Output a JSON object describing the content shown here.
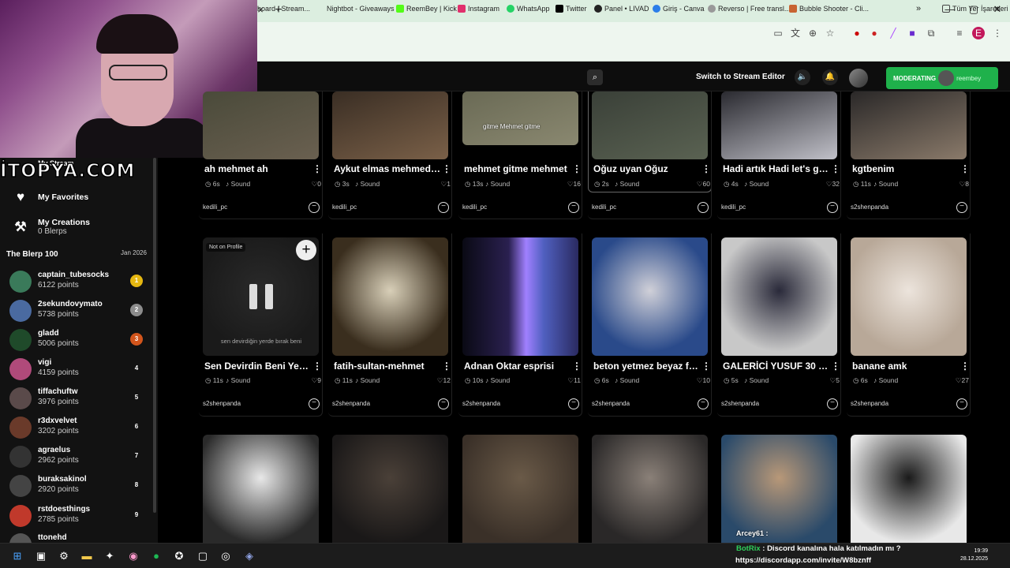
{
  "browser": {
    "tab_close": "×",
    "new_tab": "+",
    "window_controls": [
      "—",
      "▢",
      "✕"
    ],
    "bookmarks": [
      {
        "label": "board / Stream...",
        "color": "#666666"
      },
      {
        "label": "Nightbot - Giveaways",
        "color": ""
      },
      {
        "label": "ReemBey | Kick",
        "color": "#53fc18"
      },
      {
        "label": "Instagram",
        "color": "#e1306c"
      },
      {
        "label": "WhatsApp",
        "color": "#25d366"
      },
      {
        "label": "Twitter",
        "color": "#000000"
      },
      {
        "label": "Panel • LIVAD",
        "color": "#222222"
      },
      {
        "label": "Giriş - Canva",
        "color": "#2b7de9"
      },
      {
        "label": "Reverso | Free transl...",
        "color": "#999999"
      },
      {
        "label": "Bubble Shooter - Cli...",
        "color": "#c86432"
      },
      {
        "label": "Tüm Yer İşaretleri",
        "color": "#444444"
      }
    ],
    "more_bookmarks": "»"
  },
  "overlay": {
    "topya": "İTOPYA.COM"
  },
  "header": {
    "search_icon": "⌕",
    "switch_label": "Switch to Stream Editor",
    "moderating_label": "MODERATING",
    "moderating_user": "reembey",
    "volume_icon": "🔈",
    "bell_icon": "🔔"
  },
  "sidebar": {
    "my_stream": "My Stream",
    "favorites": "My Favorites",
    "creations": "My Creations",
    "creations_sub": "0 Blerps",
    "leaderboard_title": "The Blerp 100",
    "leaderboard_date": "Jan 2026",
    "leaderboard": [
      {
        "name": "captain_tubesocks",
        "points": "6122 points",
        "rank": "1",
        "color": "#3a7a5a",
        "rank_bg": "#e5b711"
      },
      {
        "name": "2sekundovymato",
        "points": "5738 points",
        "rank": "2",
        "color": "#4a6aa0",
        "rank_bg": "#8c8c8c"
      },
      {
        "name": "gladd",
        "points": "5006 points",
        "rank": "3",
        "color": "#1f4a2a",
        "rank_bg": "#d2551c"
      },
      {
        "name": "vigi",
        "points": "4159 points",
        "rank": "4",
        "color": "#b04a7a",
        "rank_bg": ""
      },
      {
        "name": "tiffachuftw",
        "points": "3976 points",
        "rank": "5",
        "color": "#5a4a4a",
        "rank_bg": ""
      },
      {
        "name": "r3dxvelvet",
        "points": "3202 points",
        "rank": "6",
        "color": "#6a3a2a",
        "rank_bg": ""
      },
      {
        "name": "agraelus",
        "points": "2962 points",
        "rank": "7",
        "color": "#333333",
        "rank_bg": ""
      },
      {
        "name": "buraksakinol",
        "points": "2920 points",
        "rank": "8",
        "color": "#444444",
        "rank_bg": ""
      },
      {
        "name": "rstdoesthings",
        "points": "2785 points",
        "rank": "9",
        "color": "#c0392b",
        "rank_bg": ""
      },
      {
        "name": "ttonehd",
        "points": "",
        "rank": "",
        "color": "#555555",
        "rank_bg": ""
      }
    ]
  },
  "cards": [
    {
      "title": "ah mehmet ah",
      "duration": "6s",
      "type": "Sound",
      "likes": "0",
      "owner": "kedili_pc"
    },
    {
      "title": "Aykut elmas mehmedi...",
      "duration": "3s",
      "type": "Sound",
      "likes": "1",
      "owner": "kedili_pc"
    },
    {
      "title": "mehmet gitme mehmet",
      "duration": "13s",
      "type": "Sound",
      "likes": "16",
      "owner": "kedili_pc",
      "caption": "gitme Mehmet gitme"
    },
    {
      "title": "Oğuz uyan Oğuz",
      "duration": "2s",
      "type": "Sound",
      "likes": "60",
      "owner": "kedili_pc"
    },
    {
      "title": "Hadi artık Hadi let's go...",
      "duration": "4s",
      "type": "Sound",
      "likes": "32",
      "owner": "kedili_pc"
    },
    {
      "title": "kgtbenim",
      "duration": "11s",
      "type": "Sound",
      "likes": "8",
      "owner": "s2shenpanda"
    },
    {
      "title": "Sen Devirdin Beni Yeğen",
      "duration": "11s",
      "type": "Sound",
      "likes": "9",
      "owner": "s2shenpanda",
      "caption": "sen devirdiğin yerde bırak beni",
      "badge": "Not on Profile"
    },
    {
      "title": "fatih-sultan-mehmet",
      "duration": "11s",
      "type": "Sound",
      "likes": "12",
      "owner": "s2shenpanda"
    },
    {
      "title": "Adnan Oktar esprisi",
      "duration": "10s",
      "type": "Sound",
      "likes": "11",
      "owner": "s2shenpanda"
    },
    {
      "title": "beton yetmez beyaz fu...",
      "duration": "6s",
      "type": "Sound",
      "likes": "10",
      "owner": "s2shenpanda"
    },
    {
      "title": "GALERİCİ YUSUF 30 Mİ...",
      "duration": "5s",
      "type": "Sound",
      "likes": "5",
      "owner": "s2shenpanda"
    },
    {
      "title": "banane amk",
      "duration": "6s",
      "type": "Sound",
      "likes": "27",
      "owner": "s2shenpanda"
    }
  ],
  "icons": {
    "more": "⋮",
    "remove": "−",
    "add": "+",
    "clock": "◷",
    "note": "♪",
    "heart": "♡"
  },
  "chat": {
    "overlay_user": "Arcey61 :",
    "botrix_name": "BotRix",
    "botrix_msg": ": Discord kanalına hala katılmadın mı ?",
    "discord_link": "https://discordapp.com/invite/W8bznff"
  },
  "taskbar": {
    "time": "19:39",
    "date": "28.12.2025"
  }
}
